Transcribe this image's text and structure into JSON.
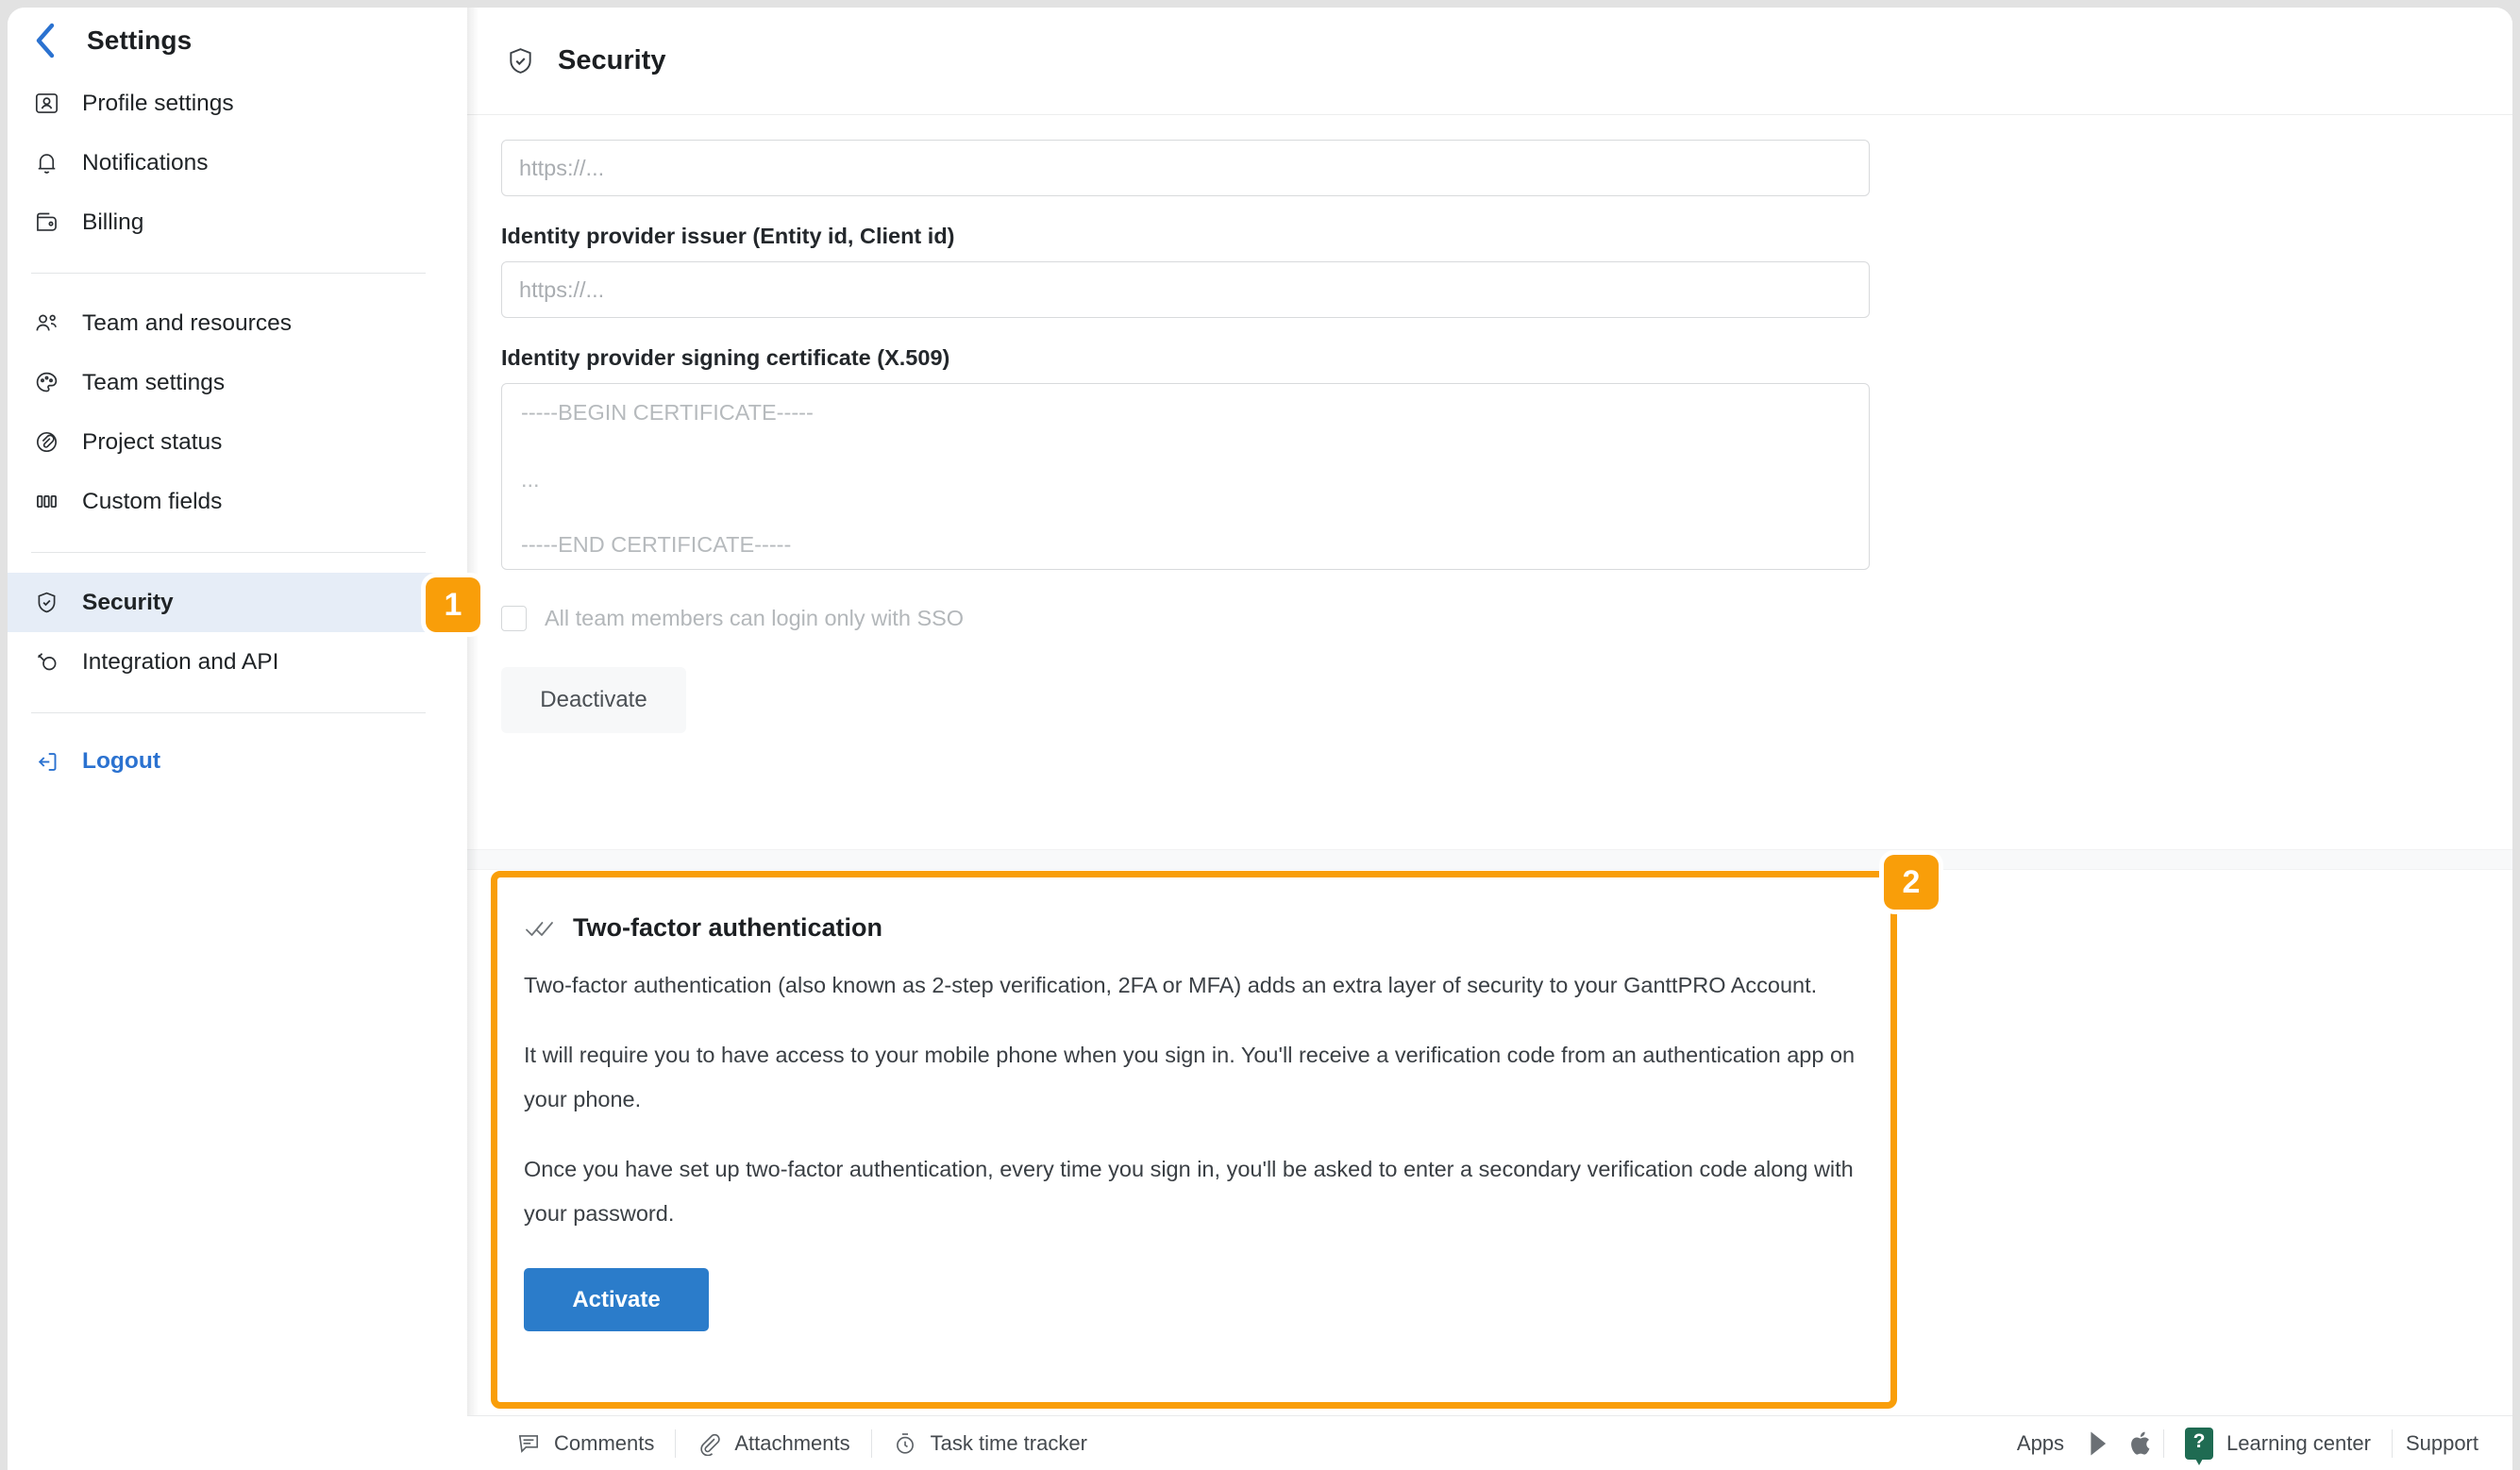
{
  "sidebar": {
    "title": "Settings",
    "back_icon": "chevron-left-icon",
    "group1": [
      {
        "label": "Profile settings",
        "icon": "user-card-icon"
      },
      {
        "label": "Notifications",
        "icon": "bell-icon"
      },
      {
        "label": "Billing",
        "icon": "wallet-icon"
      }
    ],
    "group2": [
      {
        "label": "Team and resources",
        "icon": "people-icon"
      },
      {
        "label": "Team settings",
        "icon": "palette-icon"
      },
      {
        "label": "Project status",
        "icon": "paperclip-circle-icon"
      },
      {
        "label": "Custom fields",
        "icon": "columns-icon"
      }
    ],
    "group3": [
      {
        "label": "Security",
        "icon": "shield-check-icon",
        "active": true
      },
      {
        "label": "Integration and API",
        "icon": "plug-icon",
        "active": false
      }
    ],
    "logout": {
      "label": "Logout",
      "icon": "logout-icon"
    }
  },
  "main": {
    "header": {
      "title": "Security",
      "icon": "shield-check-icon"
    },
    "sso": {
      "url_field": {
        "value": "",
        "placeholder": "https://..."
      },
      "issuer_label": "Identity provider issuer (Entity id, Client id)",
      "issuer_field": {
        "value": "",
        "placeholder": "https://..."
      },
      "certificate_label": "Identity provider signing certificate (X.509)",
      "certificate_placeholder_line1": "-----BEGIN CERTIFICATE-----",
      "certificate_placeholder_line2": "...",
      "certificate_placeholder_line3": "-----END CERTIFICATE-----",
      "sso_only_checkbox_label": "All team members can login only with SSO",
      "sso_only_checked": false,
      "deactivate_label": "Deactivate"
    },
    "two_factor": {
      "icon": "double-check-icon",
      "title": "Two-factor authentication",
      "paragraph1": "Two-factor authentication (also known as 2-step verification, 2FA or MFA) adds an extra layer of security to your GanttPRO Account.",
      "paragraph2": "It will require you to have access to your mobile phone when you sign in. You'll receive a verification code from an authentication app on your phone.",
      "paragraph3": "Once you have set up two-factor authentication, every time you sign in, you'll be asked to enter a secondary verification code along with your password.",
      "activate_label": "Activate"
    }
  },
  "callouts": {
    "badge_1": "1",
    "badge_2": "2",
    "color": "#f99e09"
  },
  "bottombar": {
    "left": [
      {
        "label": "Comments",
        "icon": "comment-icon"
      },
      {
        "label": "Attachments",
        "icon": "paperclip-icon"
      },
      {
        "label": "Task time tracker",
        "icon": "stopwatch-icon"
      }
    ],
    "apps_label": "Apps",
    "google_play_icon": "google-play-icon",
    "apple_icon": "apple-icon",
    "help_glyph": "?",
    "learning_center_label": "Learning center",
    "support_label": "Support"
  },
  "colors": {
    "accent_orange": "#f99e09",
    "primary_blue": "#2b7cca",
    "link_blue": "#2b72d0",
    "active_item_bg": "#e6edf7"
  }
}
